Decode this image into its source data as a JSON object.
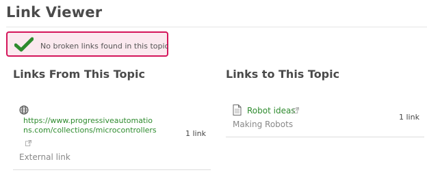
{
  "header": {
    "title": "Link Viewer"
  },
  "status": {
    "message": "No broken links found in this topic",
    "color": "#2e8b2e",
    "border": "#d4145a"
  },
  "links_from": {
    "title": "Links From This Topic",
    "items": [
      {
        "url": "https://www.progressiveautomations.com/collections/microcontrollers",
        "type": "External link",
        "count": "1 link"
      }
    ]
  },
  "links_to": {
    "title": "Links to This Topic",
    "items": [
      {
        "title": "Robot ideas",
        "subtitle": "Making Robots",
        "count": "1 link"
      }
    ]
  },
  "icons": [
    "check-icon",
    "globe-icon",
    "external-link-icon",
    "document-icon"
  ]
}
